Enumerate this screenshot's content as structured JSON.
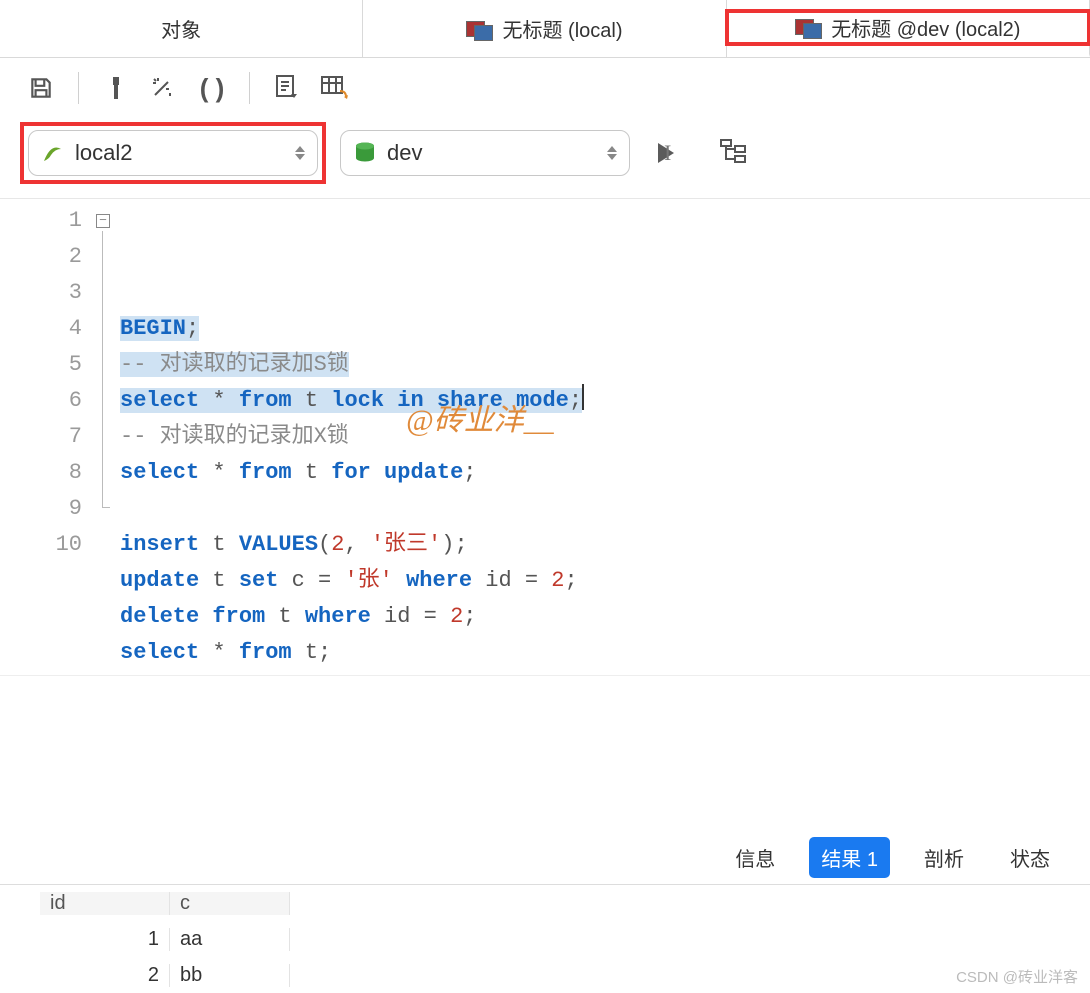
{
  "tabs": [
    {
      "label": "对象"
    },
    {
      "label": "无标题 (local)"
    },
    {
      "label": "无标题 @dev (local2)",
      "active": true,
      "highlighted": true
    }
  ],
  "toolbar_icons": [
    "save",
    "build",
    "beautify",
    "brackets",
    "text-doc",
    "result-grid"
  ],
  "connection_selector": {
    "value": "local2",
    "highlighted": true
  },
  "database_selector": {
    "value": "dev"
  },
  "run_buttons": [
    "run-current",
    "stop",
    "explain"
  ],
  "code_lines": [
    {
      "n": 1,
      "tokens": [
        [
          "kw",
          "BEGIN"
        ],
        [
          "op",
          ";"
        ]
      ],
      "highlight": true,
      "fold": "open"
    },
    {
      "n": 2,
      "tokens": [
        [
          "cm",
          "-- 对读取的记录加S锁"
        ]
      ],
      "highlight": true
    },
    {
      "n": 3,
      "tokens": [
        [
          "kw",
          "select"
        ],
        [
          "op",
          " * "
        ],
        [
          "kw",
          "from"
        ],
        [
          "op",
          " t "
        ],
        [
          "kw",
          "lock in share mode"
        ],
        [
          "op",
          ";"
        ]
      ],
      "highlight": true,
      "caret_after": true
    },
    {
      "n": 4,
      "tokens": [
        [
          "cm",
          "-- 对读取的记录加X锁"
        ]
      ]
    },
    {
      "n": 5,
      "tokens": [
        [
          "kw",
          "select"
        ],
        [
          "op",
          " * "
        ],
        [
          "kw",
          "from"
        ],
        [
          "op",
          " t "
        ],
        [
          "kw",
          "for update"
        ],
        [
          "op",
          ";"
        ]
      ]
    },
    {
      "n": 6,
      "tokens": []
    },
    {
      "n": 7,
      "tokens": [
        [
          "kw",
          "insert"
        ],
        [
          "op",
          " t "
        ],
        [
          "kw",
          "VALUES"
        ],
        [
          "op",
          "("
        ],
        [
          "num",
          "2"
        ],
        [
          "op",
          ", "
        ],
        [
          "str",
          "'张三'"
        ],
        [
          "op",
          ");"
        ]
      ]
    },
    {
      "n": 8,
      "tokens": [
        [
          "kw",
          "update"
        ],
        [
          "op",
          " t "
        ],
        [
          "kw",
          "set"
        ],
        [
          "op",
          " c = "
        ],
        [
          "str",
          "'张'"
        ],
        [
          "op",
          " "
        ],
        [
          "kw",
          "where"
        ],
        [
          "op",
          " id = "
        ],
        [
          "num",
          "2"
        ],
        [
          "op",
          ";"
        ]
      ]
    },
    {
      "n": 9,
      "tokens": [
        [
          "kw",
          "delete from"
        ],
        [
          "op",
          " t "
        ],
        [
          "kw",
          "where"
        ],
        [
          "op",
          " id = "
        ],
        [
          "num",
          "2"
        ],
        [
          "op",
          ";"
        ]
      ],
      "fold": "end"
    },
    {
      "n": 10,
      "tokens": [
        [
          "kw",
          "select"
        ],
        [
          "op",
          " * "
        ],
        [
          "kw",
          "from"
        ],
        [
          "op",
          " t;"
        ]
      ]
    }
  ],
  "watermark": "@砖业洋__",
  "corner_watermark": "CSDN @砖业洋客",
  "result_tabs": [
    {
      "label": "信息"
    },
    {
      "label": "结果 1",
      "active": true
    },
    {
      "label": "剖析"
    },
    {
      "label": "状态"
    }
  ],
  "result_columns": [
    "id",
    "c"
  ],
  "result_rows": [
    {
      "id": "1",
      "c": "aa"
    },
    {
      "id": "2",
      "c": "bb"
    }
  ]
}
